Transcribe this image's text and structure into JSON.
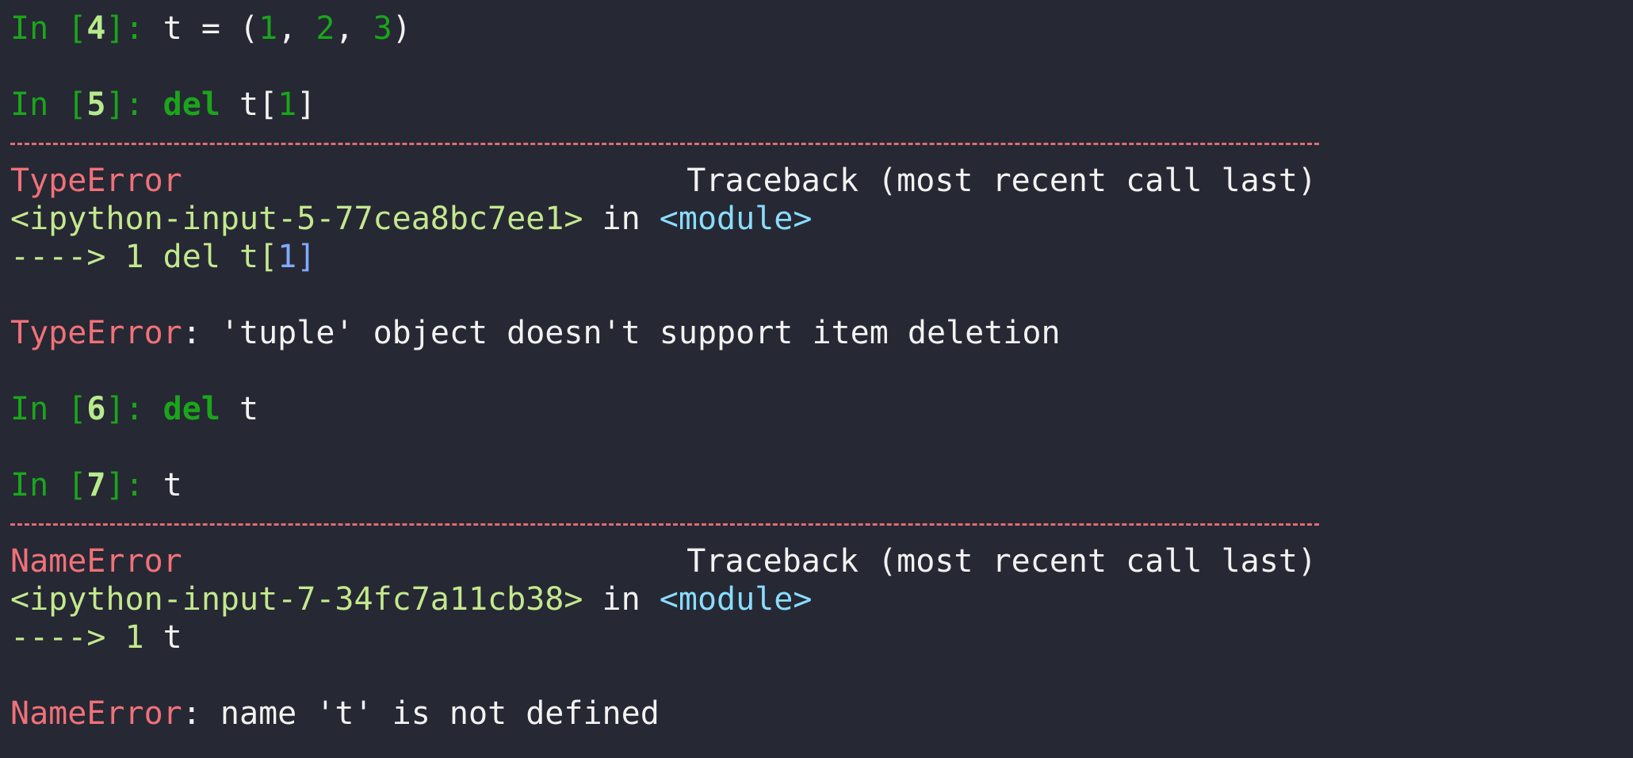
{
  "cells": {
    "in4": {
      "prompt_open": "In [",
      "num": "4",
      "prompt_close": "]: ",
      "code_a": "t = (",
      "v1": "1",
      "sep1": ", ",
      "v2": "2",
      "sep2": ", ",
      "v3": "3",
      "code_b": ")"
    },
    "in5": {
      "prompt_open": "In [",
      "num": "5",
      "prompt_close": "]: ",
      "kw": "del",
      "code_a": " t[",
      "idx": "1",
      "code_b": "]"
    },
    "tb1": {
      "error_name": "TypeError",
      "traceback_label": "Traceback (most recent call last)",
      "file": "<ipython-input-5-77cea8bc7ee1>",
      "in_word": " in ",
      "module": "<module>",
      "arrow": "----> 1 ",
      "code_a": "del t[",
      "idx": "1",
      "code_b": "]",
      "message_name": "TypeError",
      "message": ": 'tuple' object doesn't support item deletion"
    },
    "in6": {
      "prompt_open": "In [",
      "num": "6",
      "prompt_close": "]: ",
      "kw": "del",
      "code": " t"
    },
    "in7": {
      "prompt_open": "In [",
      "num": "7",
      "prompt_close": "]: ",
      "code": "t"
    },
    "tb2": {
      "error_name": "NameError",
      "traceback_label": "Traceback (most recent call last)",
      "file": "<ipython-input-7-34fc7a11cb38>",
      "in_word": " in ",
      "module": "<module>",
      "arrow": "----> 1 ",
      "code": "t",
      "message_name": "NameError",
      "message": ": name 't' is not defined"
    }
  },
  "colors": {
    "background": "#262834",
    "prompt": "#1ba51b",
    "error": "#f07178",
    "file": "#c3e88d",
    "module": "#89ddff",
    "index": "#82aaff"
  }
}
